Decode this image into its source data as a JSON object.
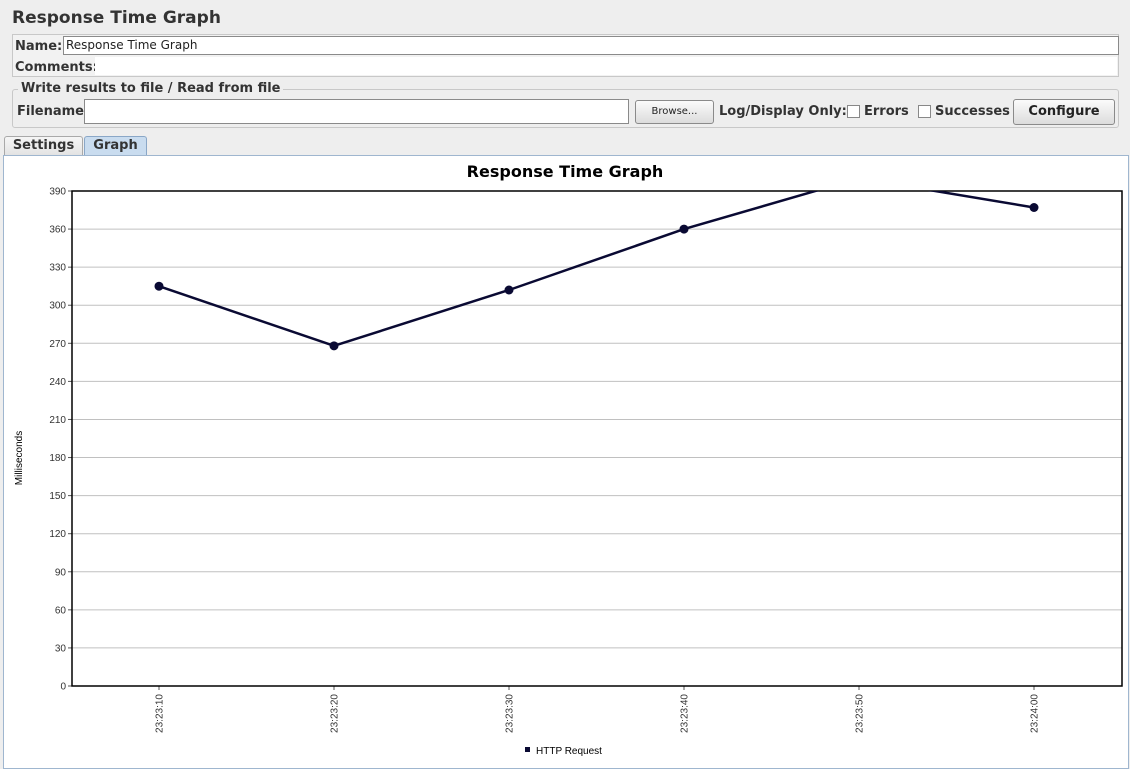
{
  "page": {
    "title": "Response Time Graph"
  },
  "form": {
    "name_label": "Name:",
    "name_value": "Response Time Graph",
    "comments_label": "Comments:"
  },
  "file_section": {
    "legend": "Write results to file / Read from file",
    "filename_label": "Filename",
    "filename_value": "",
    "browse_label": "Browse...",
    "log_display_label": "Log/Display Only:",
    "errors_label": "Errors",
    "errors_checked": false,
    "successes_label": "Successes",
    "successes_checked": false,
    "configure_label": "Configure"
  },
  "tabs": [
    {
      "label": "Settings",
      "active": false
    },
    {
      "label": "Graph",
      "active": true
    }
  ],
  "chart_data": {
    "type": "line",
    "title": "Response Time Graph",
    "xlabel": "",
    "ylabel": "Milliseconds",
    "x": [
      "23:23:10",
      "23:23:20",
      "23:23:30",
      "23:23:40",
      "23:23:50",
      "23:24:00"
    ],
    "x_ticks": [
      "23:23:10",
      "23:23:20",
      "23:23:30",
      "23:23:40",
      "23:23:50",
      "23:24:00"
    ],
    "y_ticks": [
      "0",
      "30",
      "60",
      "90",
      "120",
      "150",
      "180",
      "210",
      "240",
      "270",
      "300",
      "330",
      "360",
      "390"
    ],
    "ylim": [
      0,
      390
    ],
    "grid": true,
    "legend_position": "bottom",
    "series": [
      {
        "name": "HTTP Request",
        "color": "#0a0a33",
        "values": [
          315,
          268,
          312,
          360,
          400,
          377
        ]
      }
    ]
  }
}
